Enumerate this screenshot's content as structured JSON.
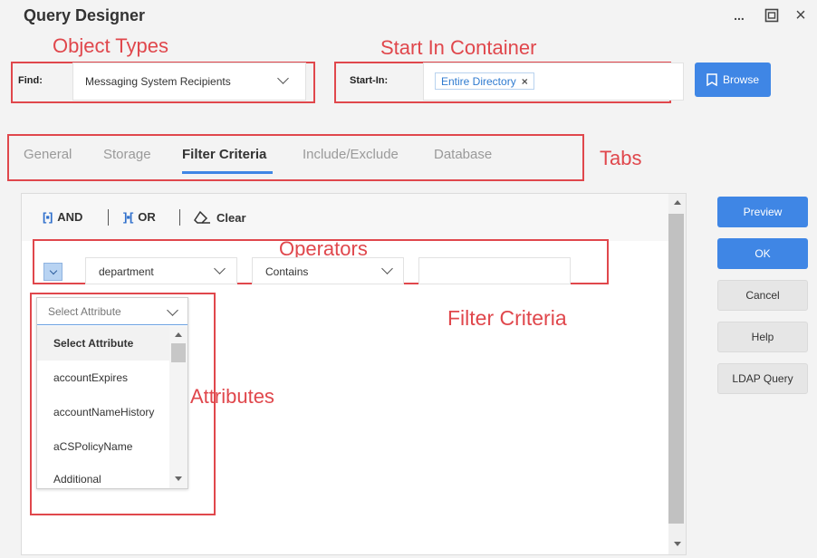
{
  "window": {
    "title": "Query Designer",
    "more_label": "...",
    "maximize_glyph": "⊡",
    "close_glyph": "×"
  },
  "annotations": {
    "object_types": "Object Types",
    "start_in_container": "Start In Container",
    "tabs": "Tabs",
    "operators": "Operators",
    "filter_criteria": "Filter Criteria",
    "attributes": "Attributes",
    "annotation_color": "#e0474c"
  },
  "find": {
    "label": "Find:",
    "value": "Messaging System Recipients"
  },
  "start_in": {
    "label": "Start-In:",
    "chip_label": "Entire Directory",
    "chip_remove": "×"
  },
  "browse_button": "Browse",
  "tabs": [
    {
      "label": "General",
      "active": false
    },
    {
      "label": "Storage",
      "active": false
    },
    {
      "label": "Filter Criteria",
      "active": true
    },
    {
      "label": "Include/Exclude",
      "active": false
    },
    {
      "label": "Database",
      "active": false
    }
  ],
  "toolbar": {
    "and_icon": "[▪]",
    "and_label": "AND",
    "or_icon": "]▪[",
    "or_label": "OR",
    "clear_label": "Clear"
  },
  "filter_row": {
    "attribute_value": "department",
    "operator_value": "Contains",
    "value_input": ""
  },
  "attribute_dropdown": {
    "placeholder": "Select Attribute",
    "items": [
      {
        "label": "Select Attribute",
        "selected": true
      },
      {
        "label": "accountExpires",
        "selected": false
      },
      {
        "label": "accountNameHistory",
        "selected": false
      },
      {
        "label": "aCSPolicyName",
        "selected": false
      },
      {
        "label": "Additional",
        "selected": false
      }
    ]
  },
  "side_buttons": {
    "preview": "Preview",
    "ok": "OK",
    "cancel": "Cancel",
    "help": "Help",
    "ldap_query": "LDAP Query"
  },
  "colors": {
    "primary": "#3f86e5",
    "link": "#2f7bd0",
    "annotation": "#e0474c"
  }
}
